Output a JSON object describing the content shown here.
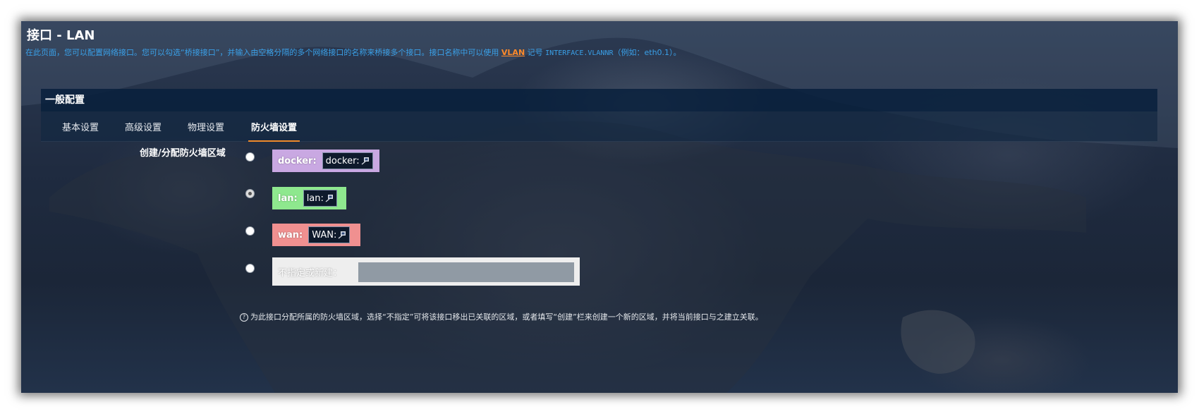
{
  "page": {
    "title": "接口 - LAN",
    "description_prefix": "在此页面，您可以配置网络接口。您可以勾选“桥接接口”，并输入由空格分隔的多个网络接口的名称来桥接多个接口。接口名称中可以使用",
    "description_link": "VLAN",
    "description_mid": "记号",
    "description_code": "INTERFACE.VLANNR",
    "description_suffix": "（例如：eth0.1）。"
  },
  "section": {
    "header": "一般配置",
    "tabs": [
      {
        "label": "基本设置",
        "active": false
      },
      {
        "label": "高级设置",
        "active": false
      },
      {
        "label": "物理设置",
        "active": false
      },
      {
        "label": "防火墙设置",
        "active": true
      }
    ]
  },
  "firewall": {
    "field_label": "创建/分配防火墙区域",
    "zones": [
      {
        "name": "docker:",
        "chip": "docker:",
        "color": "#c9a8e2",
        "checked": false,
        "icon": "network-icon"
      },
      {
        "name": "lan:",
        "chip": "lan:",
        "color": "#8ee88e",
        "checked": true,
        "icon": "network-icon"
      },
      {
        "name": "wan:",
        "chip": "WAN:",
        "color": "#f09090",
        "checked": false,
        "icon": "network-icon"
      }
    ],
    "new_zone_label": "不指定或新建：",
    "new_zone_value": "",
    "help_text": "为此接口分配所属的防火墙区域，选择“不指定”可将该接口移出已关联的区域，或者填写“创建”栏来创建一个新的区域，并将当前接口与之建立关联。",
    "help_icon": "question-circle-icon"
  }
}
